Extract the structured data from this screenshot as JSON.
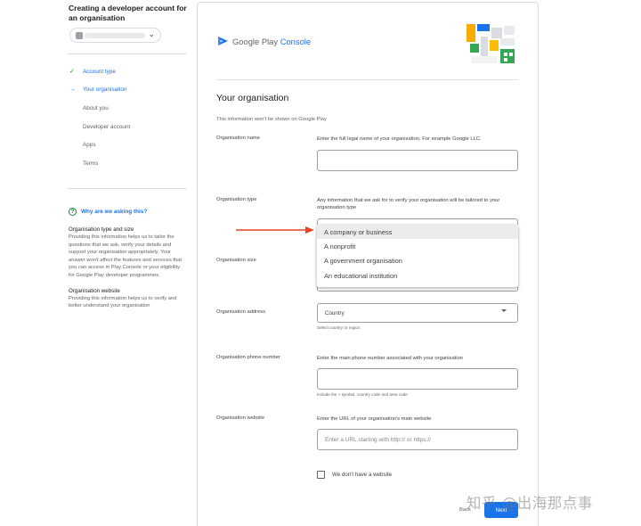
{
  "sidebar": {
    "title": "Creating a developer account for an organisation",
    "steps": [
      {
        "label": "Account type",
        "state": "done"
      },
      {
        "label": "Your organisation",
        "state": "active"
      },
      {
        "label": "About you",
        "state": ""
      },
      {
        "label": "Developer account",
        "state": ""
      },
      {
        "label": "Apps",
        "state": ""
      },
      {
        "label": "Terms",
        "state": ""
      }
    ],
    "why": {
      "heading": "Why are we asking this?",
      "sections": [
        {
          "title": "Organisation type and size",
          "body": "Providing this information helps us to tailor the questions that we ask, verify your details and support your organisation appropriately. Your answer won't affect the features and services that you can access in Play Console or your eligibility for Google Play developer programmes."
        },
        {
          "title": "Organisation website",
          "body": "Providing this information helps us to verify and better understand your organisation"
        }
      ]
    }
  },
  "header": {
    "brand_google_play": "Google Play",
    "brand_console": "Console"
  },
  "main": {
    "title": "Your organisation",
    "subtitle": "This information won't be shown on Google Play",
    "org_name": {
      "label": "Organisation name",
      "help": "Enter the full legal name of your organisation. For example Google LLC.",
      "value": ""
    },
    "org_type": {
      "label": "Organisation type",
      "help": "Any information that we ask for to verify your organisation will be tailored to your organisation type",
      "options": [
        "A company or business",
        "A nonprofit",
        "A government organisation",
        "An educational institution"
      ],
      "highlighted_index": 0
    },
    "org_size": {
      "label": "Organisation size"
    },
    "org_address": {
      "label": "Organisation address",
      "select_value": "Country",
      "hint": "Select country or region"
    },
    "org_phone": {
      "label": "Organisation phone number",
      "help": "Enter the main phone number associated with your organisation",
      "hint": "Include the + symbol, country code and area code",
      "value": ""
    },
    "org_website": {
      "label": "Organisation website",
      "help": "Enter the URL of your organisation's main website",
      "placeholder": "Enter a URL starting with http:// or https://"
    },
    "no_website_label": "We don't have a website",
    "back_label": "Back",
    "next_label": "Next"
  },
  "watermark": "知乎 @出海那点事",
  "colors": {
    "accent": "#1a73e8",
    "check": "#188038",
    "annotation_arrow": "#e8431f"
  }
}
